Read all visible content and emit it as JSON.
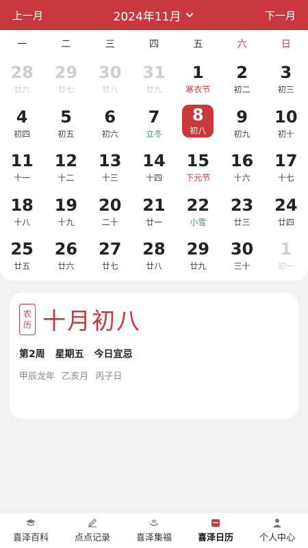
{
  "header": {
    "prev_label": "上一月",
    "title": "2024年11月",
    "next_label": "下一月"
  },
  "weekdays": [
    "一",
    "二",
    "三",
    "四",
    "五",
    "六",
    "日"
  ],
  "days": [
    {
      "n": "28",
      "s": "廿六",
      "muted": true
    },
    {
      "n": "29",
      "s": "廿七",
      "muted": true
    },
    {
      "n": "30",
      "s": "廿八",
      "muted": true
    },
    {
      "n": "31",
      "s": "廿九",
      "muted": true
    },
    {
      "n": "1",
      "s": "寒衣节",
      "kind": "festival"
    },
    {
      "n": "2",
      "s": "初二"
    },
    {
      "n": "3",
      "s": "初三"
    },
    {
      "n": "4",
      "s": "初四"
    },
    {
      "n": "5",
      "s": "初五"
    },
    {
      "n": "6",
      "s": "初六"
    },
    {
      "n": "7",
      "s": "立冬",
      "kind": "solar"
    },
    {
      "n": "8",
      "s": "初八",
      "selected": true
    },
    {
      "n": "9",
      "s": "初九"
    },
    {
      "n": "10",
      "s": "初十"
    },
    {
      "n": "11",
      "s": "十一"
    },
    {
      "n": "12",
      "s": "十二"
    },
    {
      "n": "13",
      "s": "十三"
    },
    {
      "n": "14",
      "s": "十四"
    },
    {
      "n": "15",
      "s": "下元节",
      "kind": "festival"
    },
    {
      "n": "16",
      "s": "十六"
    },
    {
      "n": "17",
      "s": "十七"
    },
    {
      "n": "18",
      "s": "十八"
    },
    {
      "n": "19",
      "s": "十九"
    },
    {
      "n": "20",
      "s": "二十"
    },
    {
      "n": "21",
      "s": "廿一"
    },
    {
      "n": "22",
      "s": "小雪",
      "kind": "solar"
    },
    {
      "n": "23",
      "s": "廿三"
    },
    {
      "n": "24",
      "s": "廿四"
    },
    {
      "n": "25",
      "s": "廿五"
    },
    {
      "n": "26",
      "s": "廿六"
    },
    {
      "n": "27",
      "s": "廿七"
    },
    {
      "n": "28",
      "s": "廿八"
    },
    {
      "n": "29",
      "s": "廿九"
    },
    {
      "n": "30",
      "s": "三十"
    },
    {
      "n": "1",
      "s": "初一",
      "muted": true
    }
  ],
  "detail": {
    "tag_top": "农",
    "tag_bottom": "历",
    "lunar_date": "十月初八",
    "week_no": "第2周",
    "weekday": "星期五",
    "yiji": "今日宜忌",
    "year_gz": "甲辰龙年",
    "month_gz": "乙亥月",
    "day_gz": "丙子日"
  },
  "tabs": [
    {
      "label": "喜泽百科",
      "icon": "graduation-cap-icon"
    },
    {
      "label": "点点记录",
      "icon": "pen-icon"
    },
    {
      "label": "喜泽集福",
      "icon": "hands-blessing-icon"
    },
    {
      "label": "喜泽日历",
      "icon": "calendar-icon",
      "active": true
    },
    {
      "label": "个人中心",
      "icon": "person-icon"
    }
  ],
  "colors": {
    "accent": "#c8393e",
    "solar_term": "#3a9a6a",
    "muted": "#cfcfcf"
  }
}
